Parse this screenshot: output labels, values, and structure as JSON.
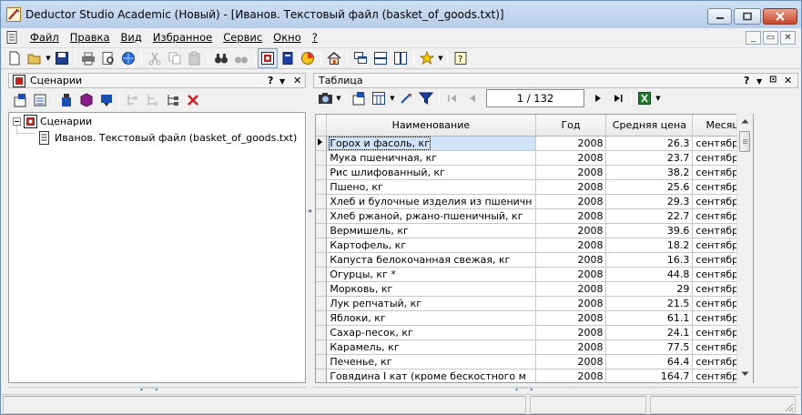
{
  "window": {
    "title": "Deductor Studio Academic (Новый) - [Иванов. Текстовый файл (basket_of_goods.txt)]"
  },
  "menu": [
    {
      "label": "Файл"
    },
    {
      "label": "Правка"
    },
    {
      "label": "Вид"
    },
    {
      "label": "Избранное"
    },
    {
      "label": "Сервис"
    },
    {
      "label": "Окно"
    },
    {
      "label": "?"
    }
  ],
  "left_panel": {
    "title": "Сценарии",
    "help": "?",
    "tree": {
      "root": "Сценарии",
      "child": "Иванов. Текстовый файл (basket_of_goods.txt)"
    }
  },
  "right_panel": {
    "title": "Таблица",
    "help": "?",
    "pager": "1 / 132"
  },
  "table": {
    "columns": [
      "Наименование",
      "Год",
      "Средняя цена",
      "Месяц"
    ],
    "rows": [
      [
        "Горох и фасоль, кг",
        "2008",
        "26.3",
        "сентябрь"
      ],
      [
        "Мука пшеничная, кг",
        "2008",
        "23.7",
        "сентябрь"
      ],
      [
        "Рис шлифованный, кг",
        "2008",
        "38.2",
        "сентябрь"
      ],
      [
        "Пшено, кг",
        "2008",
        "25.6",
        "сентябрь"
      ],
      [
        "Хлеб и булочные изделия из пшеничн",
        "2008",
        "29.3",
        "сентябрь"
      ],
      [
        "Хлеб ржаной, ржано-пшеничный, кг",
        "2008",
        "22.7",
        "сентябрь"
      ],
      [
        "Вермишель, кг",
        "2008",
        "39.6",
        "сентябрь"
      ],
      [
        "Картофель, кг",
        "2008",
        "18.2",
        "сентябрь"
      ],
      [
        "Капуста белокочанная свежая, кг",
        "2008",
        "16.3",
        "сентябрь"
      ],
      [
        "Огурцы, кг *",
        "2008",
        "44.8",
        "сентябрь"
      ],
      [
        "Морковь, кг",
        "2008",
        "29",
        "сентябрь"
      ],
      [
        "Лук репчатый, кг",
        "2008",
        "21.5",
        "сентябрь"
      ],
      [
        "Яблоки, кг",
        "2008",
        "61.1",
        "сентябрь"
      ],
      [
        "Сахар-песок, кг",
        "2008",
        "24.1",
        "сентябрь"
      ],
      [
        "Карамель, кг",
        "2008",
        "77.5",
        "сентябрь"
      ],
      [
        "Печенье, кг",
        "2008",
        "64.4",
        "сентябрь"
      ],
      [
        "Говядина I кат (кроме бескостного м",
        "2008",
        "164.7",
        "сентябрь"
      ]
    ],
    "selected_row": 0
  }
}
